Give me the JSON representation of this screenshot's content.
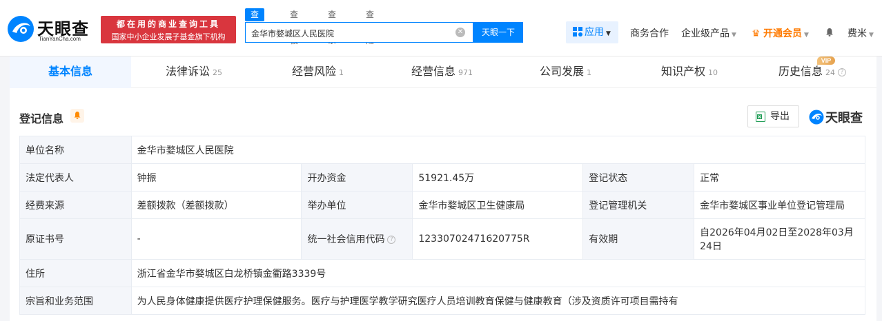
{
  "header": {
    "logo_cn": "天眼查",
    "logo_en": "TianYanCha.com",
    "promo_line1": "都在用的商业查询工具",
    "promo_line2": "国家中小企业发展子基金旗下机构",
    "search_tabs": [
      "查公司",
      "查老板",
      "查关系",
      "查风险"
    ],
    "search_value": "金华市婺城区人民医院",
    "search_button": "天眼一下",
    "nav": {
      "app": "应用",
      "business": "商务合作",
      "enterprise": "企业级产品",
      "vip": "开通会员",
      "user": "费米"
    }
  },
  "tabs": [
    {
      "label": "基本信息",
      "count": ""
    },
    {
      "label": "法律诉讼",
      "count": "25"
    },
    {
      "label": "经营风险",
      "count": "1"
    },
    {
      "label": "经营信息",
      "count": "971"
    },
    {
      "label": "公司发展",
      "count": "1"
    },
    {
      "label": "知识产权",
      "count": "10"
    },
    {
      "label": "历史信息",
      "count": "24"
    }
  ],
  "vip_badge": "VIP",
  "section": {
    "title": "登记信息",
    "export": "导出",
    "brand": "天眼查"
  },
  "registration": {
    "unit_name_label": "单位名称",
    "unit_name": "金华市婺城区人民医院",
    "legal_rep_label": "法定代表人",
    "legal_rep": "钟振",
    "capital_label": "开办资金",
    "capital": "51921.45万",
    "status_label": "登记状态",
    "status": "正常",
    "funding_label": "经费来源",
    "funding": "差额拨款（差额拨款）",
    "organizer_label": "举办单位",
    "organizer": "金华市婺城区卫生健康局",
    "authority_label": "登记管理机关",
    "authority": "金华市婺城区事业单位登记管理局",
    "cert_label": "原证书号",
    "cert": "-",
    "credit_label": "统一社会信用代码",
    "credit": "12330702471620775R",
    "validity_label": "有效期",
    "validity": "自2026年04月02日至2028年03月24日",
    "address_label": "住所",
    "address": "浙江省金华市婺城区白龙桥镇金衢路3339号",
    "scope_label": "宗旨和业务范围",
    "scope": "为人民身体健康提供医疗护理保健服务。医疗与护理医学教学研究医疗人员培训教育保健与健康教育（涉及资质许可项目需持有"
  }
}
